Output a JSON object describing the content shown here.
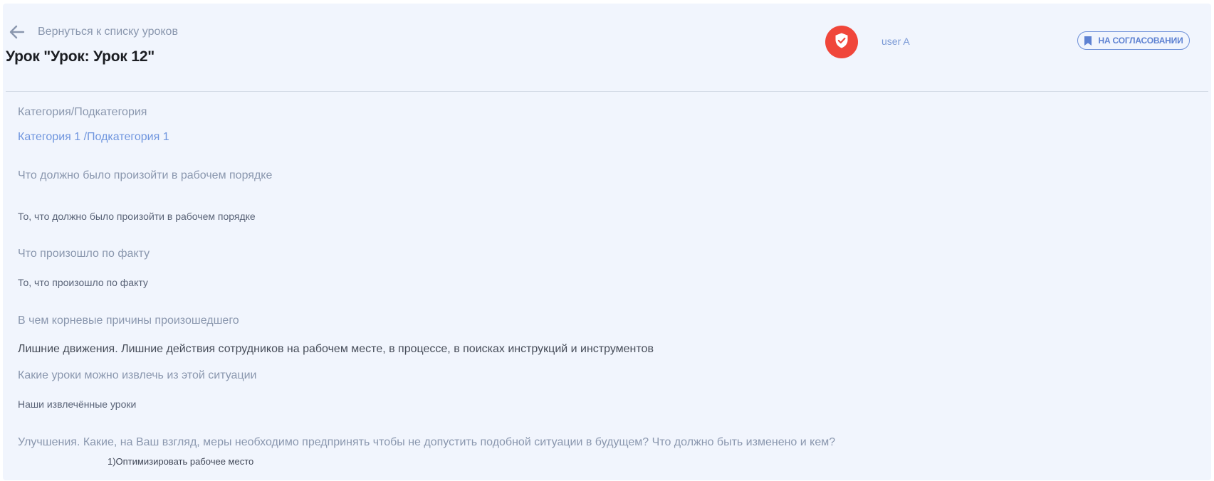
{
  "header": {
    "back_label": "Вернуться к списку уроков",
    "title": "Урок \"Урок: Урок 12\"",
    "user_name": "user A",
    "status": "НА СОГЛАСОВАНИИ"
  },
  "colors": {
    "background": "#f1f5fd",
    "avatar": "#f0463a",
    "accent": "#6f95de",
    "label": "#8a97ae"
  },
  "icons": {
    "back": "arrow-left-icon",
    "avatar": "shield-check-icon",
    "status": "bookmark-icon"
  },
  "fields": {
    "category_label": "Категория/Подкатегория",
    "category_value": "Категория 1 /Подкатегория 1",
    "expected_label": "Что должно было произойти в рабочем порядке",
    "expected_value": "То, что должно было произойти в рабочем порядке",
    "actual_label": "Что произошло по факту",
    "actual_value": "То, что произошло по факту",
    "root_causes_label": "В чем корневые причины произошедшего",
    "root_causes_value": "Лишние движения. Лишние действия сотрудников на рабочем месте, в процессе, в поисках инструкций и инструментов",
    "lessons_label": "Какие уроки можно извлечь из этой ситуации",
    "lessons_value": "Наши извлечённые уроки",
    "improvements_label": "Улучшения. Какие, на Ваш взгляд, меры необходимо предпринять чтобы не допустить подобной ситуации в будущем? Что должно быть изменено и кем?",
    "improvements_value": "1)Оптимизировать рабочее место"
  }
}
